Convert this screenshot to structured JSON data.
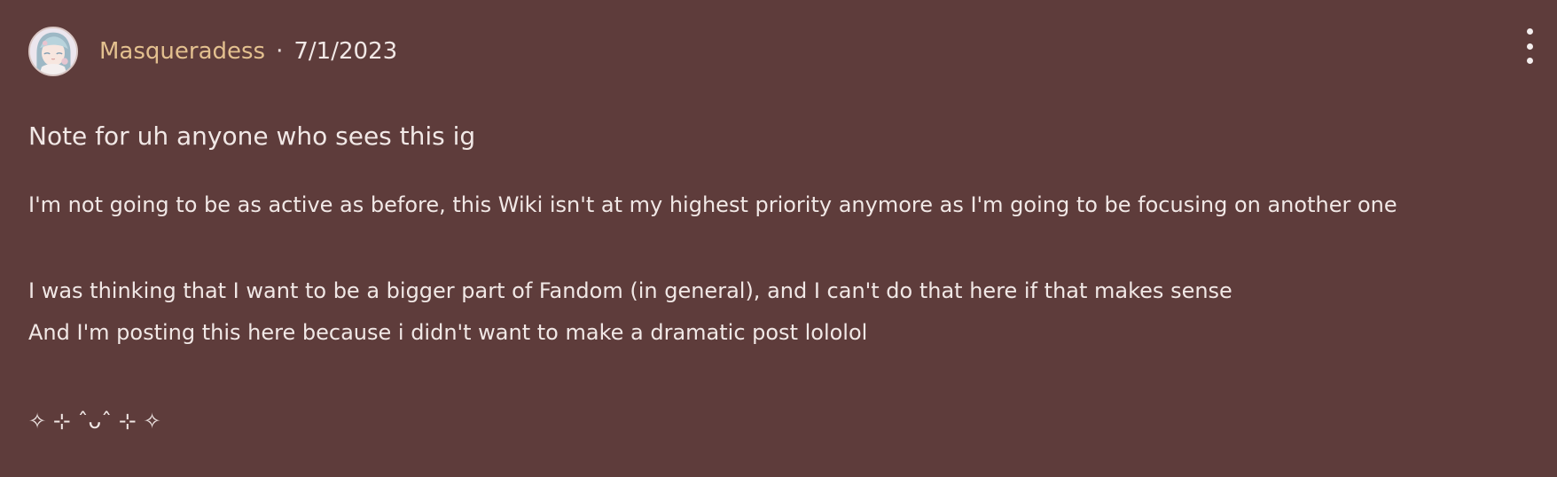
{
  "post": {
    "author": "Masqueradess",
    "separator": "·",
    "date": "7/1/2023",
    "title": "Note for uh anyone who sees this ig",
    "body_lines": [
      "I'm not going to be as active as before, this Wiki isn't at my highest priority anymore as I'm going to be focusing on another one",
      "I was thinking that I want to be a bigger part of Fandom (in general), and I can't do that here if that makes sense",
      "And I'm posting this here because i didn't want to make a dramatic post lololol"
    ],
    "decoration": "✧ ⊹ ˆᴗˆ ⊹ ✧"
  },
  "icons": {
    "avatar": "avatar-image",
    "menu": "more-vertical-icon"
  },
  "colors": {
    "background": "#5e3c3b",
    "author": "#e3c08f",
    "text": "#f1e8e6"
  }
}
